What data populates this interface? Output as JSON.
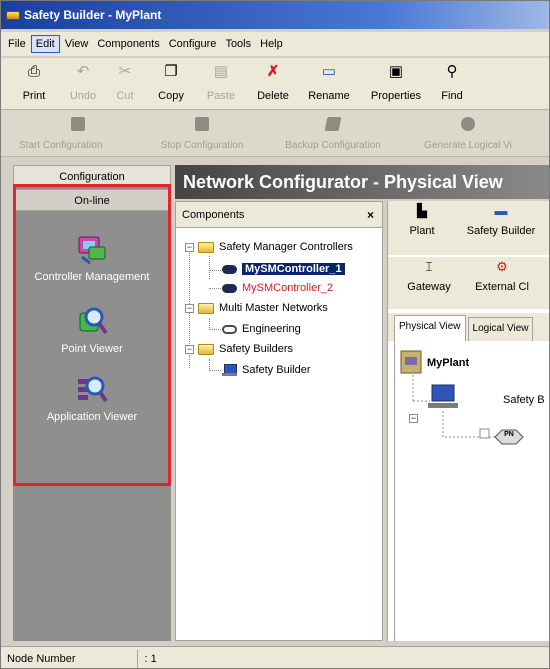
{
  "window": {
    "title": "Safety Builder - MyPlant"
  },
  "menu": [
    "File",
    "Edit",
    "View",
    "Components",
    "Configure",
    "Tools",
    "Help"
  ],
  "menu_active": "Edit",
  "toolbar": [
    {
      "label": "Print",
      "icon": "print-icon",
      "enabled": true
    },
    {
      "label": "Undo",
      "icon": "undo-icon",
      "enabled": false
    },
    {
      "label": "Cut",
      "icon": "cut-icon",
      "enabled": false
    },
    {
      "label": "Copy",
      "icon": "copy-icon",
      "enabled": true
    },
    {
      "label": "Paste",
      "icon": "paste-icon",
      "enabled": false
    },
    {
      "label": "Delete",
      "icon": "delete-icon",
      "enabled": true
    },
    {
      "label": "Rename",
      "icon": "rename-icon",
      "enabled": true
    },
    {
      "label": "Properties",
      "icon": "properties-icon",
      "enabled": true
    },
    {
      "label": "Find",
      "icon": "find-icon",
      "enabled": true
    }
  ],
  "config_toolbar": [
    {
      "label": "Start Configuration",
      "enabled": false
    },
    {
      "label": "Stop Configuration",
      "enabled": false
    },
    {
      "label": "Backup Configuration",
      "enabled": false
    },
    {
      "label": "Generate Logical Vi",
      "enabled": false
    }
  ],
  "leftnav": {
    "tab_configuration": "Configuration",
    "tab_online": "On-line",
    "items": [
      {
        "label": "Controller Management",
        "icon": "controller-management-icon"
      },
      {
        "label": "Point Viewer",
        "icon": "point-viewer-icon"
      },
      {
        "label": "Application Viewer",
        "icon": "application-viewer-icon"
      }
    ]
  },
  "header": {
    "title": "Network Configurator - Physical View"
  },
  "components": {
    "title": "Components",
    "close": "×",
    "tree": {
      "controllers_label": "Safety Manager Controllers",
      "controller_1": "MySMController_1",
      "controller_2": "MySMController_2",
      "networks_label": "Multi Master Networks",
      "engineering": "Engineering",
      "builders_label": "Safety Builders",
      "safety_builder": "Safety Builder"
    }
  },
  "rightpanel": {
    "row1": [
      "Plant",
      "Safety Builder"
    ],
    "row2": [
      "Gateway",
      "External Cl"
    ],
    "tabs": [
      "Physical View",
      "Logical View"
    ],
    "canvas": {
      "root": "MyPlant",
      "node": "Safety B",
      "net_label": "PN"
    }
  },
  "status": {
    "label": "Node Number",
    "value": ": 1"
  },
  "colors": {
    "highlight": "#e0262a",
    "selection": "#0a246a",
    "controller2": "#d21c1c"
  }
}
